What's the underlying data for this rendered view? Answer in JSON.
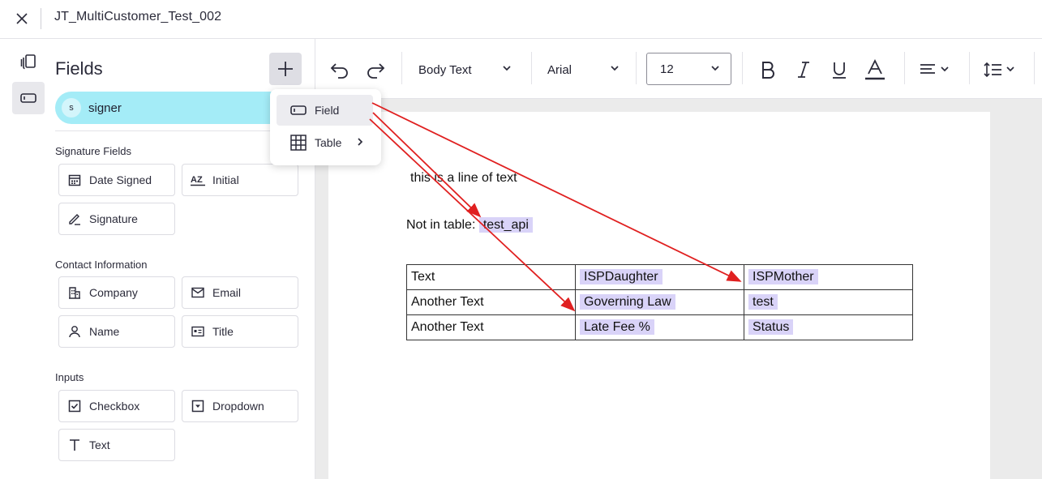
{
  "header": {
    "close_icon": "close-icon",
    "title": "JT_MultiCustomer_Test_002"
  },
  "rail": {
    "items": [
      {
        "icon": "pages-icon",
        "active": false
      },
      {
        "icon": "field-icon",
        "active": true
      }
    ]
  },
  "panel": {
    "title": "Fields",
    "add_icon": "plus-icon",
    "signer": {
      "initial": "s",
      "name": "signer",
      "color": "#a4ecf7"
    },
    "sections": [
      {
        "label": "Signature Fields",
        "items": [
          {
            "label": "Date Signed",
            "icon": "calendar-icon"
          },
          {
            "label": "Initial",
            "icon": "initials-icon"
          },
          {
            "label": "Signature",
            "icon": "pen-icon"
          }
        ]
      },
      {
        "label": "Contact Information",
        "items": [
          {
            "label": "Company",
            "icon": "building-icon"
          },
          {
            "label": "Email",
            "icon": "envelope-icon"
          },
          {
            "label": "Name",
            "icon": "person-icon"
          },
          {
            "label": "Title",
            "icon": "id-card-icon"
          }
        ]
      },
      {
        "label": "Inputs",
        "items": [
          {
            "label": "Checkbox",
            "icon": "checkbox-icon"
          },
          {
            "label": "Dropdown",
            "icon": "dropdown-icon"
          },
          {
            "label": "Text",
            "icon": "text-icon"
          }
        ]
      }
    ]
  },
  "toolbar": {
    "style": "Body Text",
    "font": "Arial",
    "size": "12",
    "icons": [
      "undo-icon",
      "redo-icon",
      "bold-icon",
      "italic-icon",
      "underline-icon",
      "text-color-icon",
      "align-left-icon",
      "line-spacing-icon"
    ]
  },
  "menu": {
    "items": [
      {
        "label": "Field",
        "icon": "field-icon"
      },
      {
        "label": "Table",
        "icon": "table-icon"
      }
    ]
  },
  "document": {
    "line1": "this is a line of text",
    "line2_label": "Not in table: ",
    "line2_field": "test_api",
    "table": [
      [
        {
          "text": "Text",
          "field": false
        },
        {
          "text": "ISPDaughter",
          "field": true
        },
        {
          "text": "ISPMother",
          "field": true
        }
      ],
      [
        {
          "text": "Another Text",
          "field": false
        },
        {
          "text": "Governing Law",
          "field": true
        },
        {
          "text": "test",
          "field": true
        }
      ],
      [
        {
          "text": "Another Text",
          "field": false
        },
        {
          "text": "Late Fee %",
          "field": true
        },
        {
          "text": "Status",
          "field": true
        }
      ]
    ]
  },
  "colors": {
    "field_chip": "#d9d3f8",
    "signer": "#a4ecf7",
    "annotation_arrow": "#e02020"
  }
}
